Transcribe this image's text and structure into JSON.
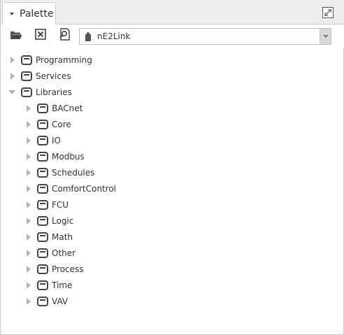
{
  "palette": {
    "tab_title": "Palette",
    "maximize_icon": "maximize-icon"
  },
  "toolbar": {
    "open_icon": "folder-open-icon",
    "close_icon": "close-box-icon",
    "find_icon": "find-icon",
    "module_select": {
      "value": "nE2Link",
      "icon": "database-icon"
    }
  },
  "tree": [
    {
      "label": "Programming",
      "level": 0,
      "expanded": false
    },
    {
      "label": "Services",
      "level": 0,
      "expanded": false
    },
    {
      "label": "Libraries",
      "level": 0,
      "expanded": true
    },
    {
      "label": "BACnet",
      "level": 1,
      "expanded": false
    },
    {
      "label": "Core",
      "level": 1,
      "expanded": false
    },
    {
      "label": "IO",
      "level": 1,
      "expanded": false
    },
    {
      "label": "Modbus",
      "level": 1,
      "expanded": false
    },
    {
      "label": "Schedules",
      "level": 1,
      "expanded": false
    },
    {
      "label": "ComfortControl",
      "level": 1,
      "expanded": false
    },
    {
      "label": "FCU",
      "level": 1,
      "expanded": false
    },
    {
      "label": "Logic",
      "level": 1,
      "expanded": false
    },
    {
      "label": "Math",
      "level": 1,
      "expanded": false
    },
    {
      "label": "Other",
      "level": 1,
      "expanded": false
    },
    {
      "label": "Process",
      "level": 1,
      "expanded": false
    },
    {
      "label": "Time",
      "level": 1,
      "expanded": false
    },
    {
      "label": "VAV",
      "level": 1,
      "expanded": false
    }
  ],
  "colors": {
    "tab_bar": "#ededed",
    "expander_arrow": "#b3b3b3",
    "icon_dark": "#444444"
  }
}
